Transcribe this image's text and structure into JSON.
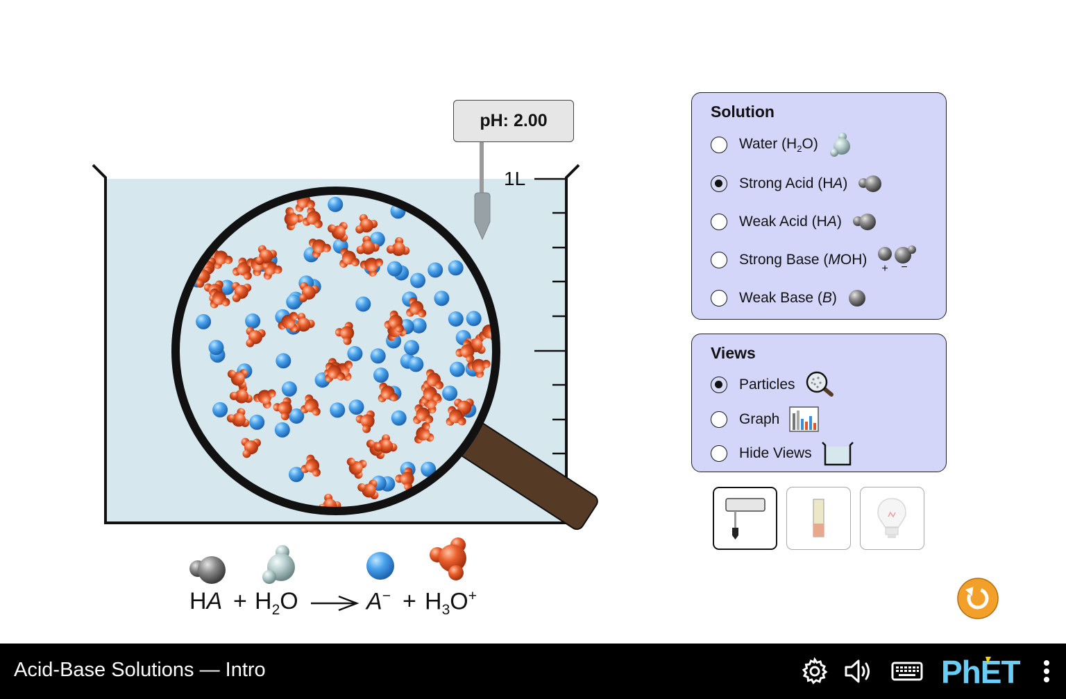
{
  "app": {
    "title": "Acid-Base Solutions — Intro",
    "brand": "PhET"
  },
  "ph_meter": {
    "readout": "pH: 2.00"
  },
  "beaker": {
    "volume_label": "1L"
  },
  "solution_panel": {
    "title": "Solution",
    "selected": "strong-acid",
    "options": [
      {
        "id": "water",
        "prefix": "Water (H",
        "sub": "2",
        "suffix": "O)",
        "icon": "water-molecule-icon"
      },
      {
        "id": "strong-acid",
        "prefix": "Strong Acid (H",
        "ital": "A",
        "suffix": ")",
        "icon": "acid-molecule-icon"
      },
      {
        "id": "weak-acid",
        "prefix": "Weak Acid (H",
        "ital": "A",
        "suffix": ")",
        "icon": "acid-molecule-icon"
      },
      {
        "id": "strong-base",
        "prefix": "Strong Base (",
        "ital": "M",
        "suffix": "OH)",
        "icon": "base-ions-icon"
      },
      {
        "id": "weak-base",
        "prefix": "Weak Base (",
        "ital": "B",
        "suffix": ")",
        "icon": "weak-base-molecule-icon"
      }
    ],
    "strong_base_charge_plus": "+",
    "strong_base_charge_minus": "−"
  },
  "views_panel": {
    "title": "Views",
    "selected": "particles",
    "options": [
      {
        "id": "particles",
        "label": "Particles",
        "icon": "magnifier-icon"
      },
      {
        "id": "graph",
        "label": "Graph",
        "icon": "bar-graph-icon"
      },
      {
        "id": "hide-views",
        "label": "Hide Views",
        "icon": "beaker-icon"
      }
    ]
  },
  "tools": {
    "selected": "ph-meter",
    "items": [
      "ph-meter",
      "ph-paper",
      "conductivity-tester"
    ]
  },
  "equation": {
    "reactant1": "H",
    "reactant1_ital": "A",
    "plus": "+",
    "reactant2_a": "H",
    "reactant2_sub": "2",
    "reactant2_b": "O",
    "product1_ital": "A",
    "product1_sup": "−",
    "product2_a": "H",
    "product2_sub": "3",
    "product2_b": "O",
    "product2_sup": "+"
  },
  "colors": {
    "panel_bg": "#d3d5f9",
    "solution": "#d7e7ee",
    "hydronium": "#e3562a",
    "anion": "#3a8fdd",
    "handle": "#553a26",
    "reset": "#f3a02b",
    "phet_blue": "#6acdf5",
    "phet_yellow": "#f5d400"
  }
}
